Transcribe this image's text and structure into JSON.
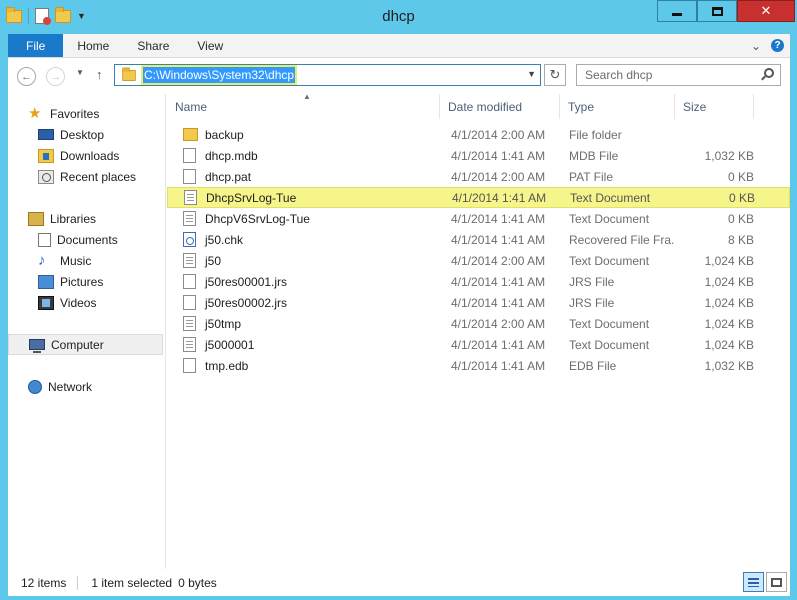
{
  "window": {
    "title": "dhcp"
  },
  "titlebar": {
    "minimize": "minimize",
    "maximize": "maximize",
    "close": "✕"
  },
  "ribbon": {
    "tabs": [
      {
        "label": "File"
      },
      {
        "label": "Home"
      },
      {
        "label": "Share"
      },
      {
        "label": "View"
      }
    ],
    "help": "?"
  },
  "navbar": {
    "address": "C:\\Windows\\System32\\dhcp",
    "search_placeholder": "Search dhcp"
  },
  "sidebar": {
    "favorites": {
      "label": "Favorites",
      "items": [
        {
          "label": "Desktop"
        },
        {
          "label": "Downloads"
        },
        {
          "label": "Recent places"
        }
      ]
    },
    "libraries": {
      "label": "Libraries",
      "items": [
        {
          "label": "Documents"
        },
        {
          "label": "Music"
        },
        {
          "label": "Pictures"
        },
        {
          "label": "Videos"
        }
      ]
    },
    "computer": {
      "label": "Computer"
    },
    "network": {
      "label": "Network"
    }
  },
  "filelist": {
    "columns": {
      "name": "Name",
      "date": "Date modified",
      "type": "Type",
      "size": "Size"
    },
    "rows": [
      {
        "name": "backup",
        "date": "4/1/2014 2:00 AM",
        "type": "File folder",
        "size": "",
        "icon": "folder-icon"
      },
      {
        "name": "dhcp.mdb",
        "date": "4/1/2014 1:41 AM",
        "type": "MDB File",
        "size": "1,032 KB",
        "icon": "file-icon"
      },
      {
        "name": "dhcp.pat",
        "date": "4/1/2014 2:00 AM",
        "type": "PAT File",
        "size": "0 KB",
        "icon": "file-icon"
      },
      {
        "name": "DhcpSrvLog-Tue",
        "date": "4/1/2014 1:41 AM",
        "type": "Text Document",
        "size": "0 KB",
        "icon": "text-file-icon",
        "selected": true
      },
      {
        "name": "DhcpV6SrvLog-Tue",
        "date": "4/1/2014 1:41 AM",
        "type": "Text Document",
        "size": "0 KB",
        "icon": "text-file-icon"
      },
      {
        "name": "j50.chk",
        "date": "4/1/2014 1:41 AM",
        "type": "Recovered File Fra...",
        "size": "8 KB",
        "icon": "chk-file-icon"
      },
      {
        "name": "j50",
        "date": "4/1/2014 2:00 AM",
        "type": "Text Document",
        "size": "1,024 KB",
        "icon": "text-file-icon"
      },
      {
        "name": "j50res00001.jrs",
        "date": "4/1/2014 1:41 AM",
        "type": "JRS File",
        "size": "1,024 KB",
        "icon": "file-icon"
      },
      {
        "name": "j50res00002.jrs",
        "date": "4/1/2014 1:41 AM",
        "type": "JRS File",
        "size": "1,024 KB",
        "icon": "file-icon"
      },
      {
        "name": "j50tmp",
        "date": "4/1/2014 2:00 AM",
        "type": "Text Document",
        "size": "1,024 KB",
        "icon": "text-file-icon"
      },
      {
        "name": "j5000001",
        "date": "4/1/2014 1:41 AM",
        "type": "Text Document",
        "size": "1,024 KB",
        "icon": "text-file-icon"
      },
      {
        "name": "tmp.edb",
        "date": "4/1/2014 1:41 AM",
        "type": "EDB File",
        "size": "1,032 KB",
        "icon": "file-icon"
      }
    ]
  },
  "status": {
    "items_count": "12 items",
    "selection": "1 item selected",
    "selection_size": "0 bytes"
  },
  "colors": {
    "frame": "#5ec8ea",
    "file_tab": "#1979ca",
    "close_button": "#c7302f",
    "selection_highlight": "#f6f58a"
  }
}
